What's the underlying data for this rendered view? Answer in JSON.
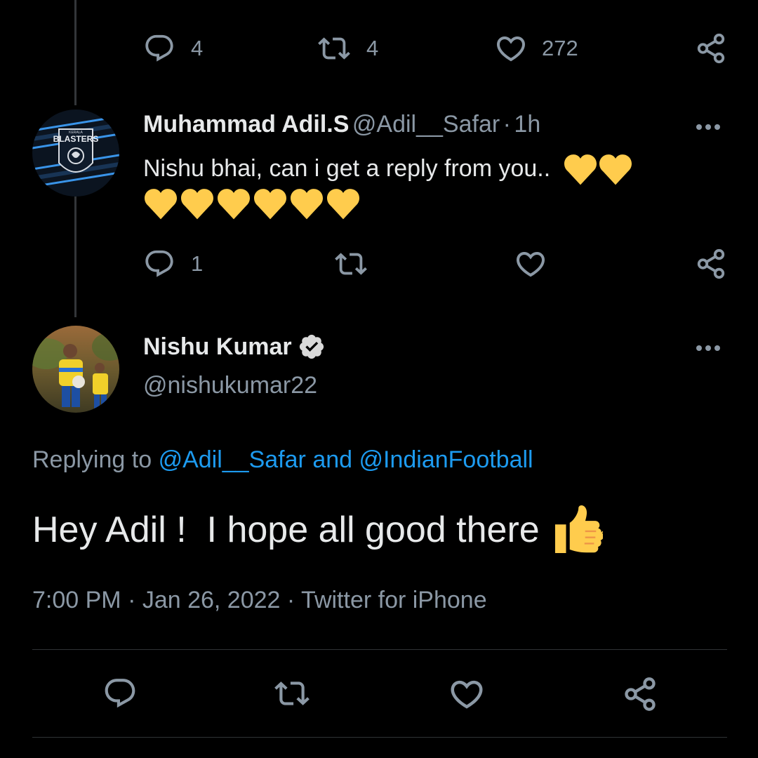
{
  "top_tweet": {
    "reply_count": "4",
    "retweet_count": "4",
    "like_count": "272"
  },
  "reply_tweet": {
    "display_name": "Muhammad Adil.S",
    "handle": "@Adil__Safar",
    "separator": "·",
    "time": "1h",
    "text": "Nishu bhai, can i get a reply from you..",
    "reply_count": "1",
    "retweet_count": "",
    "like_count": "",
    "avatar_text": "BLASTERS",
    "avatar_small_text": "KERALA"
  },
  "main_tweet": {
    "display_name": "Nishu Kumar",
    "handle": "@nishukumar22",
    "replying_prefix": "Replying to",
    "replying_user1": "@Adil__Safar",
    "replying_and": "and",
    "replying_user2": "@IndianFootball",
    "text": "Hey Adil !  I hope all good there",
    "timestamp": "7:00 PM · Jan 26, 2022 · Twitter for iPhone"
  },
  "colors": {
    "background": "#000000",
    "text": "#e7e9ea",
    "secondary": "#8b98a5",
    "link": "#1d9bf0",
    "heart_emoji": "#ffcc4d",
    "divider": "#2f3336"
  },
  "icons": {
    "reply": "reply-icon",
    "retweet": "retweet-icon",
    "like": "heart-icon",
    "share": "share-icon",
    "verified": "verified-badge-icon",
    "more": "more-options-icon",
    "emoji_heart": "yellow-heart-emoji",
    "emoji_thumbs": "thumbs-up-emoji"
  }
}
